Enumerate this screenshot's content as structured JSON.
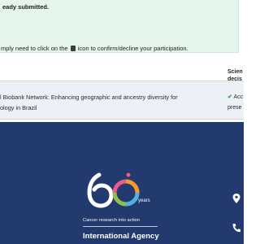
{
  "alert": {
    "title": "eady submitted.",
    "text_before_icon": "mply need to click on the",
    "text_after_icon": "icon to confirm/decline your participation."
  },
  "table": {
    "column_header_line1": "Scien",
    "column_header_line2": "decis",
    "row_line1": "l Biobank Network: Enhancing geographic and ancestry diversity for",
    "row_line2": "ology in Brazil",
    "decision_line1": "Acc",
    "decision_line2": "prese"
  },
  "footer": {
    "logo_years": "years",
    "tagline": "Cancer research into action",
    "agency": "International Agency"
  },
  "colors": {
    "footer_bg": "#223a6d",
    "alert_bg": "#e4f5ec",
    "row_bg": "#eef0f8",
    "check": "#2e9b46"
  }
}
